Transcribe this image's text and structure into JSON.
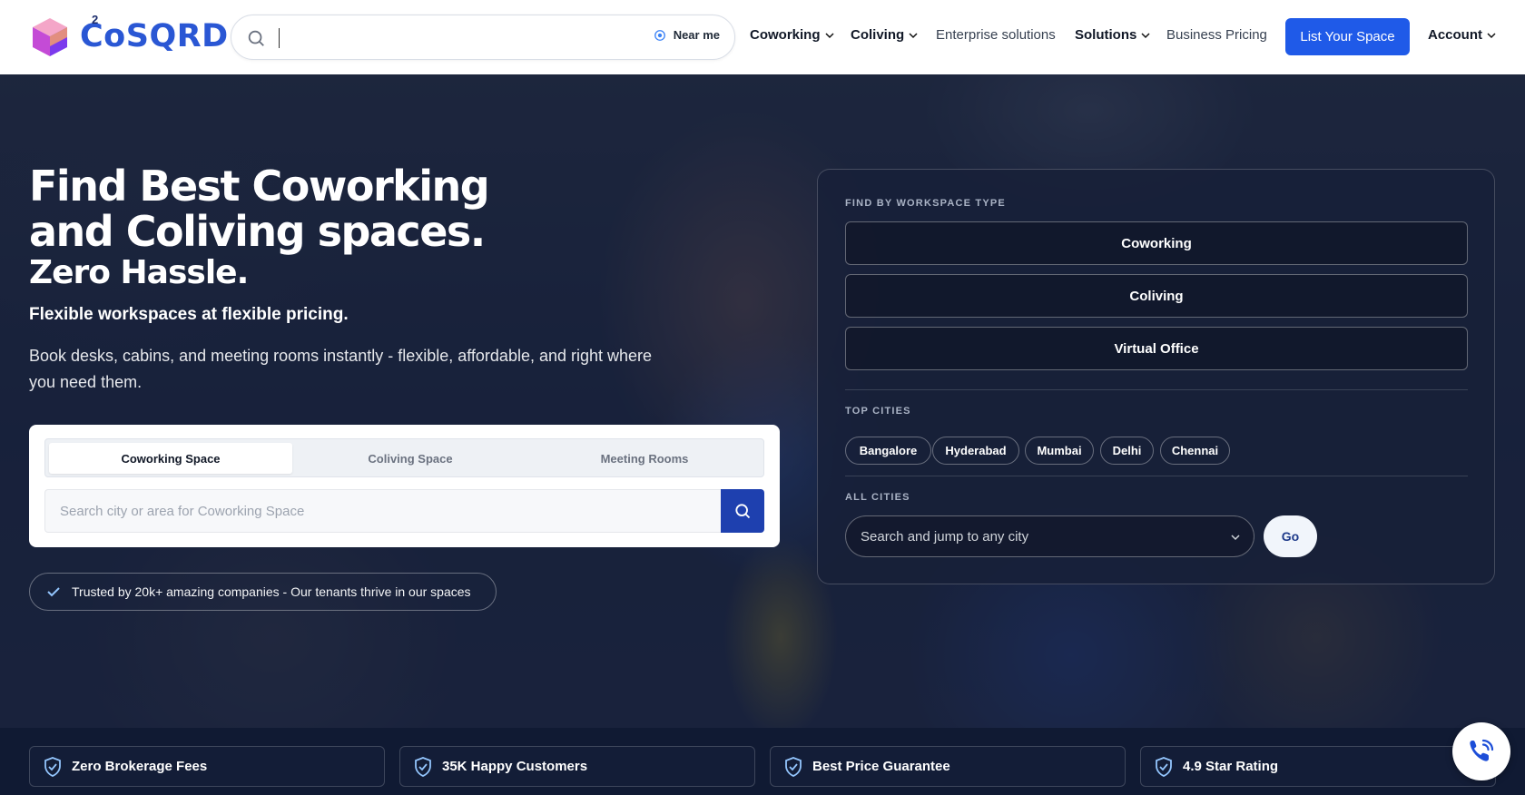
{
  "brand": {
    "name": "CoSQRD",
    "superscript": "2"
  },
  "header_search": {
    "placeholder": "",
    "near_me_label": "Near me"
  },
  "nav": {
    "coworking": "Coworking",
    "coliving": "Coliving",
    "enterprise": "Enterprise solutions",
    "solutions": "Solutions",
    "pricing": "Business Pricing",
    "list_space": "List Your Space",
    "account": "Account"
  },
  "hero": {
    "title_line1": "Find Best Coworking",
    "title_line2": "and Coliving spaces.",
    "subtitle": "Zero Hassle.",
    "tagline": "Flexible workspaces at flexible pricing.",
    "description": "Book desks, cabins, and meeting rooms instantly - flexible, affordable, and right where you need them."
  },
  "search_card": {
    "tabs": [
      {
        "label": "Coworking Space",
        "active": true
      },
      {
        "label": "Coliving Space",
        "active": false
      },
      {
        "label": "Meeting Rooms",
        "active": false
      }
    ],
    "input_placeholder": "Search city or area for Coworking Space"
  },
  "trusted_text": "Trusted by 20k+ amazing companies - Our tenants thrive in our spaces",
  "panel": {
    "workspace_label": "FIND BY WORKSPACE TYPE",
    "workspace_types": [
      "Coworking",
      "Coliving",
      "Virtual Office"
    ],
    "top_cities_label": "TOP CITIES",
    "top_cities": [
      "Bangalore",
      "Hyderabad",
      "Mumbai",
      "Delhi",
      "Chennai"
    ],
    "all_cities_label": "ALL CITIES",
    "all_cities_placeholder": "Search and jump to any city",
    "go_label": "Go"
  },
  "features": [
    "Zero Brokerage Fees",
    "35K Happy Customers",
    "Best Price Guarantee",
    "4.9 Star Rating"
  ],
  "colors": {
    "accent": "#1f5ae8",
    "brand": "#2a57d4",
    "dark": "#101a33"
  }
}
